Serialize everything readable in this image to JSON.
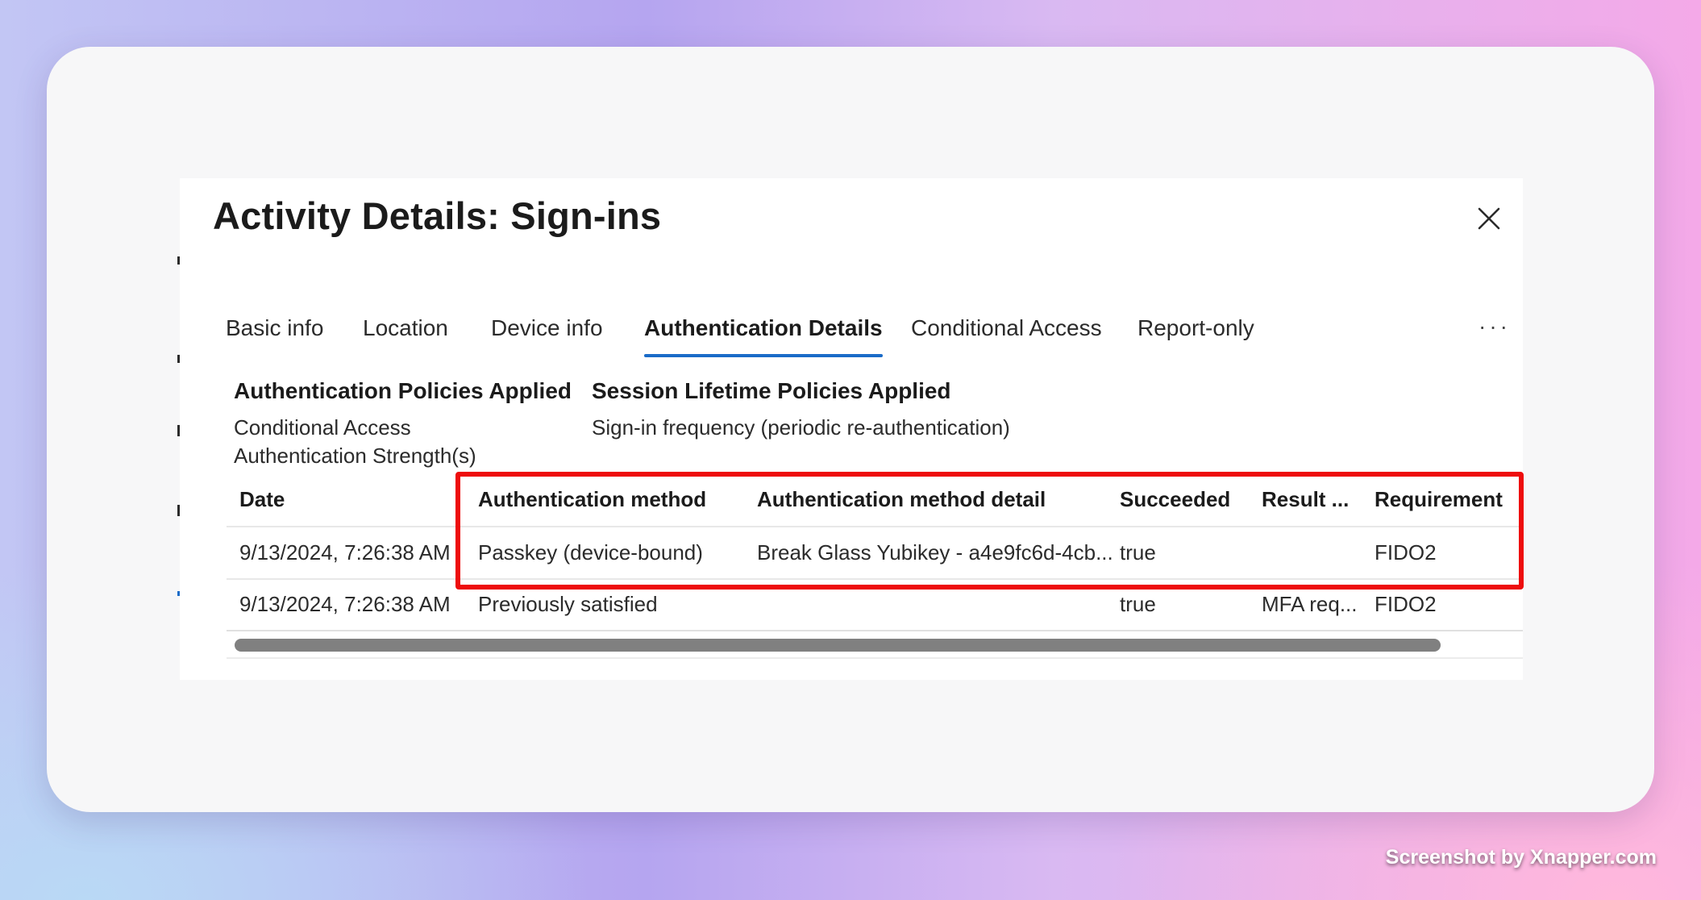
{
  "panel": {
    "title": "Activity Details: Sign-ins"
  },
  "tabs": [
    {
      "label": "Basic info"
    },
    {
      "label": "Location"
    },
    {
      "label": "Device info"
    },
    {
      "label": "Authentication Details",
      "active": true
    },
    {
      "label": "Conditional Access"
    },
    {
      "label": "Report-only"
    }
  ],
  "more_label": "···",
  "auth_policies": {
    "heading": "Authentication Policies Applied",
    "line1": "Conditional Access",
    "line2": "Authentication Strength(s)"
  },
  "session_policies": {
    "heading": "Session Lifetime Policies Applied",
    "line1": "Sign-in frequency (periodic re-authentication)"
  },
  "table": {
    "columns": {
      "date": "Date",
      "method": "Authentication method",
      "detail": "Authentication method detail",
      "succeeded": "Succeeded",
      "result": "Result ...",
      "requirement": "Requirement"
    },
    "rows": [
      {
        "date": "9/13/2024, 7:26:38 AM",
        "method": "Passkey (device-bound)",
        "detail": "Break Glass Yubikey - a4e9fc6d-4cb...",
        "succeeded": "true",
        "result": "",
        "requirement": "FIDO2"
      },
      {
        "date": "9/13/2024, 7:26:38 AM",
        "method": "Previously satisfied",
        "detail": "",
        "succeeded": "true",
        "result": "MFA req...",
        "requirement": "FIDO2"
      }
    ]
  },
  "colors": {
    "highlight": "#ee0c0c",
    "active_tab_underline": "#1a6bc8",
    "scrollbar_thumb": "#808080"
  },
  "watermark": "Screenshot by Xnapper.com"
}
